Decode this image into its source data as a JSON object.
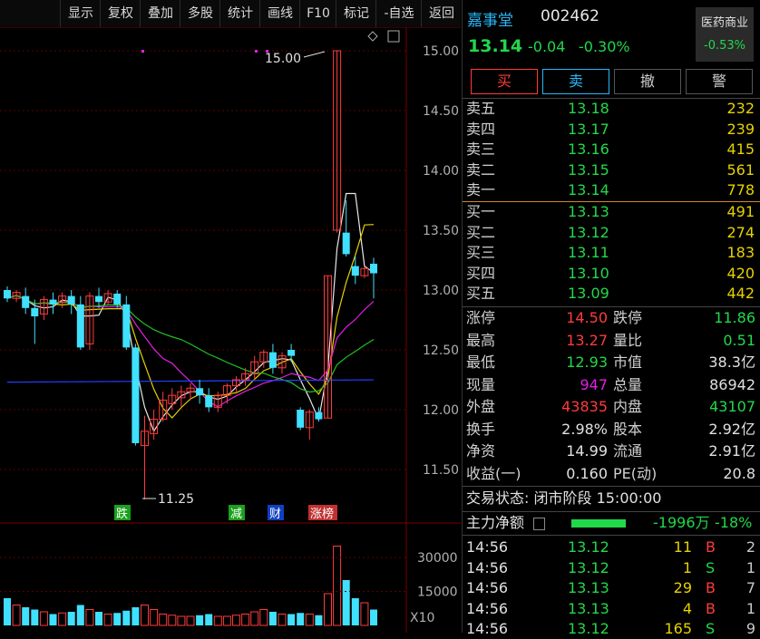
{
  "toolbar": [
    "显示",
    "复权",
    "叠加",
    "多股",
    "统计",
    "画线",
    "F10",
    "标记",
    "-自选",
    "返回"
  ],
  "stock": {
    "name": "嘉事堂",
    "code": "002462",
    "price": "13.14",
    "change": "-0.04",
    "change_pct": "-0.30%",
    "sector": "医药商业",
    "sector_pct": "-0.53%"
  },
  "trade_buttons": [
    "买",
    "卖",
    "撤",
    "警"
  ],
  "asks": [
    {
      "label": "卖五",
      "price": "13.18",
      "vol": "232"
    },
    {
      "label": "卖四",
      "price": "13.17",
      "vol": "239"
    },
    {
      "label": "卖三",
      "price": "13.16",
      "vol": "415"
    },
    {
      "label": "卖二",
      "price": "13.15",
      "vol": "561"
    },
    {
      "label": "卖一",
      "price": "13.14",
      "vol": "778"
    }
  ],
  "bids": [
    {
      "label": "买一",
      "price": "13.13",
      "vol": "491"
    },
    {
      "label": "买二",
      "price": "13.12",
      "vol": "274"
    },
    {
      "label": "买三",
      "price": "13.11",
      "vol": "183"
    },
    {
      "label": "买四",
      "price": "13.10",
      "vol": "420"
    },
    {
      "label": "买五",
      "price": "13.09",
      "vol": "442"
    }
  ],
  "stats": [
    {
      "l1": "涨停",
      "v1": "14.50",
      "c1": "red",
      "l2": "跌停",
      "v2": "11.86",
      "c2": "green"
    },
    {
      "l1": "最高",
      "v1": "13.27",
      "c1": "red",
      "l2": "量比",
      "v2": "0.51",
      "c2": "green"
    },
    {
      "l1": "最低",
      "v1": "12.93",
      "c1": "green",
      "l2": "市值",
      "v2": "38.3亿",
      "c2": "white"
    },
    {
      "l1": "现量",
      "v1": "947",
      "c1": "mag",
      "l2": "总量",
      "v2": "86942",
      "c2": "white"
    },
    {
      "l1": "外盘",
      "v1": "43835",
      "c1": "red",
      "l2": "内盘",
      "v2": "43107",
      "c2": "green"
    },
    {
      "l1": "换手",
      "v1": "2.98%",
      "c1": "white",
      "l2": "股本",
      "v2": "2.92亿",
      "c2": "white"
    },
    {
      "l1": "净资",
      "v1": "14.99",
      "c1": "white",
      "l2": "流通",
      "v2": "2.91亿",
      "c2": "white"
    },
    {
      "l1": "收益(一)",
      "v1": "0.160",
      "c1": "white",
      "l2": "PE(动)",
      "v2": "20.8",
      "c2": "white"
    }
  ],
  "status_line": "交易状态: 闭市阶段 15:00:00",
  "main_flow": {
    "label": "主力净额",
    "value": "-1996万",
    "pct": "-18%"
  },
  "ticks": [
    {
      "t": "14:56",
      "p": "13.12",
      "v": "11",
      "d": "B",
      "n": "2"
    },
    {
      "t": "14:56",
      "p": "13.12",
      "v": "1",
      "d": "S",
      "n": "1"
    },
    {
      "t": "14:56",
      "p": "13.13",
      "v": "29",
      "d": "B",
      "n": "7"
    },
    {
      "t": "14:56",
      "p": "13.13",
      "v": "4",
      "d": "B",
      "n": "1"
    },
    {
      "t": "14:56",
      "p": "13.12",
      "v": "165",
      "d": "S",
      "n": "9"
    }
  ],
  "chart": {
    "y_ticks": [
      "15.00",
      "14.50",
      "14.00",
      "13.50",
      "13.00",
      "12.50",
      "12.00",
      "11.50"
    ],
    "high_label": "15.00",
    "low_label": "11.25",
    "event_tags": [
      "跌",
      "减",
      "财",
      "涨榜"
    ],
    "vol_ticks": [
      "30000",
      "15000"
    ],
    "vol_unit": "X10"
  },
  "chart_data": {
    "type": "candlestick",
    "ylim": [
      11.25,
      15.1
    ],
    "candles": [
      {
        "o": 13.0,
        "h": 13.03,
        "c": 12.93,
        "l": 12.9
      },
      {
        "o": 12.93,
        "h": 13.0,
        "c": 12.98,
        "l": 12.9
      },
      {
        "o": 12.95,
        "h": 13.02,
        "c": 12.85,
        "l": 12.8
      },
      {
        "o": 12.85,
        "h": 12.92,
        "c": 12.78,
        "l": 12.55
      },
      {
        "o": 12.8,
        "h": 12.95,
        "c": 12.92,
        "l": 12.75
      },
      {
        "o": 12.92,
        "h": 12.98,
        "c": 12.88,
        "l": 12.8
      },
      {
        "o": 12.9,
        "h": 12.98,
        "c": 12.95,
        "l": 12.85
      },
      {
        "o": 12.95,
        "h": 13.0,
        "c": 12.88,
        "l": 12.8
      },
      {
        "o": 12.88,
        "h": 12.95,
        "c": 12.52,
        "l": 12.5
      },
      {
        "o": 12.55,
        "h": 12.98,
        "c": 12.95,
        "l": 12.5
      },
      {
        "o": 12.95,
        "h": 13.02,
        "c": 12.9,
        "l": 12.85
      },
      {
        "o": 12.9,
        "h": 13.0,
        "c": 12.97,
        "l": 12.88
      },
      {
        "o": 12.97,
        "h": 13.0,
        "c": 12.88,
        "l": 12.85
      },
      {
        "o": 12.88,
        "h": 12.95,
        "c": 12.52,
        "l": 12.5
      },
      {
        "o": 12.52,
        "h": 12.55,
        "c": 11.72,
        "l": 11.7
      },
      {
        "o": 11.7,
        "h": 11.95,
        "c": 11.82,
        "l": 11.25
      },
      {
        "o": 11.8,
        "h": 12.0,
        "c": 11.92,
        "l": 11.75
      },
      {
        "o": 11.92,
        "h": 12.15,
        "c": 12.08,
        "l": 11.9
      },
      {
        "o": 12.05,
        "h": 12.18,
        "c": 12.12,
        "l": 12.0
      },
      {
        "o": 12.1,
        "h": 12.2,
        "c": 12.15,
        "l": 12.02
      },
      {
        "o": 12.15,
        "h": 12.22,
        "c": 12.18,
        "l": 12.08
      },
      {
        "o": 12.18,
        "h": 12.25,
        "c": 12.12,
        "l": 12.05
      },
      {
        "o": 12.12,
        "h": 12.18,
        "c": 12.02,
        "l": 11.98
      },
      {
        "o": 12.02,
        "h": 12.15,
        "c": 12.12,
        "l": 11.98
      },
      {
        "o": 12.12,
        "h": 12.22,
        "c": 12.2,
        "l": 12.05
      },
      {
        "o": 12.2,
        "h": 12.28,
        "c": 12.25,
        "l": 12.15
      },
      {
        "o": 12.25,
        "h": 12.35,
        "c": 12.3,
        "l": 12.2
      },
      {
        "o": 12.3,
        "h": 12.45,
        "c": 12.4,
        "l": 12.25
      },
      {
        "o": 12.4,
        "h": 12.5,
        "c": 12.48,
        "l": 12.35
      },
      {
        "o": 12.48,
        "h": 12.55,
        "c": 12.35,
        "l": 12.3
      },
      {
        "o": 12.35,
        "h": 12.48,
        "c": 12.45,
        "l": 12.3
      },
      {
        "o": 12.5,
        "h": 12.55,
        "c": 12.45,
        "l": 12.4
      },
      {
        "o": 12.0,
        "h": 12.02,
        "c": 11.85,
        "l": 11.83
      },
      {
        "o": 11.85,
        "h": 12.0,
        "c": 11.98,
        "l": 11.75
      },
      {
        "o": 11.98,
        "h": 12.02,
        "c": 11.92,
        "l": 11.9
      },
      {
        "o": 11.93,
        "h": 13.12,
        "c": 13.12,
        "l": 11.93
      },
      {
        "o": 13.5,
        "h": 15.0,
        "c": 15.0,
        "l": 13.48
      },
      {
        "o": 13.48,
        "h": 13.75,
        "c": 13.3,
        "l": 13.28
      },
      {
        "o": 13.2,
        "h": 13.28,
        "c": 13.12,
        "l": 13.05
      },
      {
        "o": 13.12,
        "h": 13.2,
        "c": 13.18,
        "l": 13.1
      },
      {
        "o": 13.22,
        "h": 13.27,
        "c": 13.14,
        "l": 12.93
      }
    ],
    "volume": [
      12000,
      9000,
      8000,
      7000,
      6000,
      5000,
      5500,
      6000,
      9000,
      7000,
      6000,
      5000,
      5500,
      6500,
      8000,
      9000,
      7000,
      5000,
      4500,
      4000,
      4000,
      4500,
      5000,
      4000,
      4000,
      4500,
      5000,
      6000,
      7000,
      6000,
      5000,
      5000,
      5500,
      5000,
      4500,
      14000,
      35000,
      20000,
      12000,
      10000,
      7000
    ],
    "vol_ylim": [
      0,
      40000
    ]
  }
}
